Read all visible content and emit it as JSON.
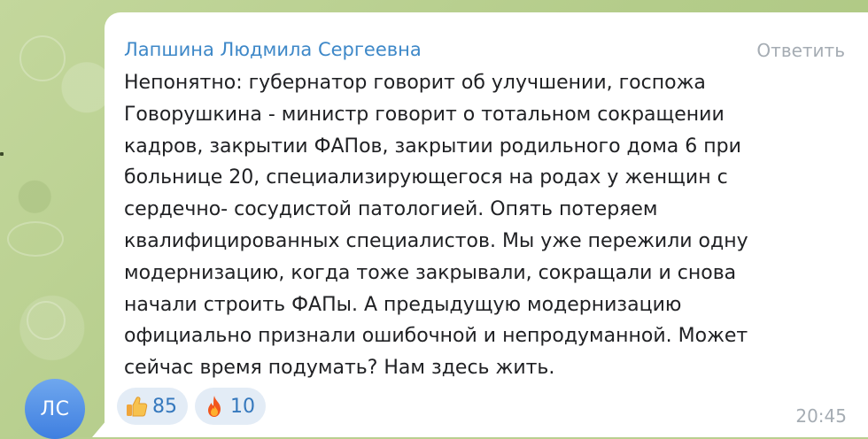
{
  "message": {
    "sender_initials": "ЛС",
    "sender_name": "Лапшина Людмила Сергеевна",
    "reply_label": "Ответить",
    "text_lines": [
      "Непонятно: губернатор говорит об улучшении,  госпожа",
      "Говорушкина - министр говорит о тотальном сокращении",
      "кадров, закрытии ФАПов, закрытии родильного дома 6 при",
      "больнице 20, специализирующегося на родах у женщин с",
      "сердечно- сосудистой патологией. Опять потеряем",
      "квалифицированных специалистов. Мы уже пережили одну",
      "модернизацию, когда тоже закрывали, сокращали и снова",
      "начали строить ФАПы. А предыдущую модернизацию",
      "официально признали ошибочной и непродуманной. Может",
      "сейчас время подумать?  Нам здесь жить."
    ],
    "reactions": [
      {
        "icon": "thumbs-up-icon",
        "count": "85"
      },
      {
        "icon": "fire-icon",
        "count": "10"
      }
    ],
    "time": "20:45"
  },
  "colors": {
    "sender_name": "#3e88c8",
    "avatar": "#4a8ae6",
    "reaction_bg": "#e3ecf6",
    "reaction_count": "#3578bd",
    "meta_text": "#a5acb3",
    "chat_background": "#b9cf90"
  }
}
